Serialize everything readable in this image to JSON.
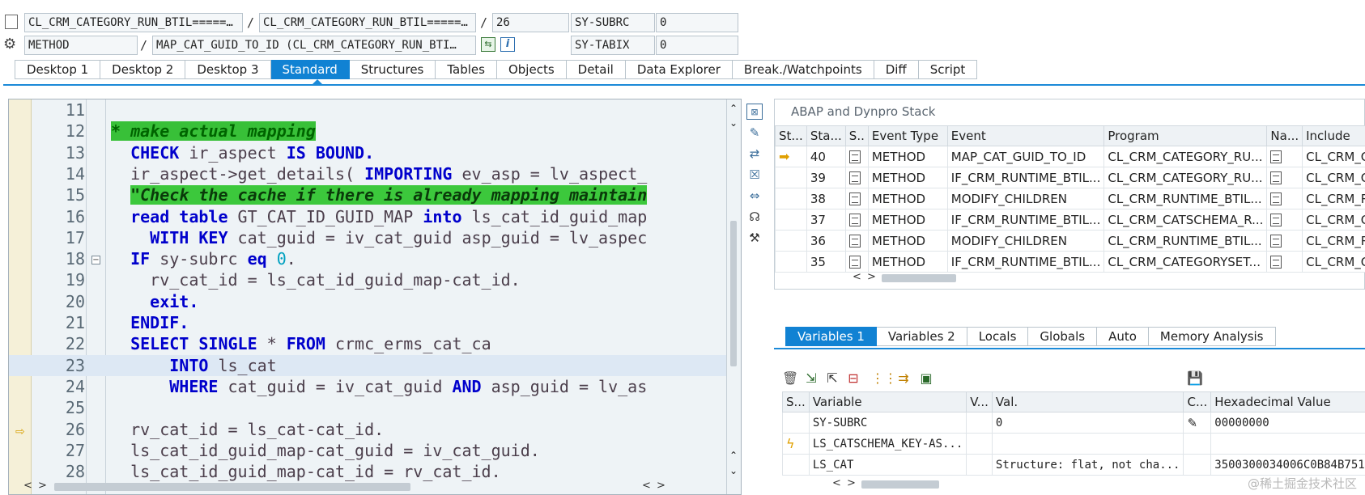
{
  "header": {
    "program_field": "CL_CRM_CATEGORY_RUN_BTIL=====…",
    "program_field2": "CL_CRM_CATEGORY_RUN_BTIL=====…",
    "line_no": "26",
    "sysfield1_name": "SY-SUBRC",
    "sysfield1_value": "0",
    "type_label": "METHOD",
    "method_field": "MAP_CAT_GUID_TO_ID (CL_CRM_CATEGORY_RUN_BTI…",
    "sysfield2_name": "SY-TABIX",
    "sysfield2_value": "0",
    "slash": "/"
  },
  "tabs": [
    {
      "label": "Desktop 1",
      "active": false
    },
    {
      "label": "Desktop 2",
      "active": false
    },
    {
      "label": "Desktop 3",
      "active": false
    },
    {
      "label": "Standard",
      "active": true
    },
    {
      "label": "Structures",
      "active": false
    },
    {
      "label": "Tables",
      "active": false
    },
    {
      "label": "Objects",
      "active": false
    },
    {
      "label": "Detail",
      "active": false
    },
    {
      "label": "Data Explorer",
      "active": false
    },
    {
      "label": "Break./Watchpoints",
      "active": false
    },
    {
      "label": "Diff",
      "active": false
    },
    {
      "label": "Script",
      "active": false
    }
  ],
  "code": {
    "lines": [
      {
        "n": "11",
        "segs": []
      },
      {
        "n": "12",
        "segs": [
          {
            "t": "* make actual mapping",
            "c": "cm"
          }
        ]
      },
      {
        "n": "13",
        "segs": [
          {
            "t": "  CHECK",
            "c": "kw"
          },
          {
            "t": " ir_aspect ",
            "c": "mono"
          },
          {
            "t": "IS BOUND",
            "c": "kw"
          },
          {
            "t": ".",
            "c": "kw"
          }
        ]
      },
      {
        "n": "14",
        "segs": [
          {
            "t": "  ir_aspect->get_details( ",
            "c": "mono"
          },
          {
            "t": "IMPORTING",
            "c": "kw"
          },
          {
            "t": " ev_asp = lv_aspect_",
            "c": "mono"
          }
        ]
      },
      {
        "n": "15",
        "segs": [
          {
            "t": "  ",
            "c": "mono"
          },
          {
            "t": "\"Check the cache if there is already mapping maintain",
            "c": "cm2"
          }
        ]
      },
      {
        "n": "16",
        "segs": [
          {
            "t": "  read table",
            "c": "kw"
          },
          {
            "t": " GT_CAT_ID_GUID_MAP ",
            "c": "mono"
          },
          {
            "t": "into",
            "c": "kw"
          },
          {
            "t": " ls_cat_id_guid_map",
            "c": "mono"
          }
        ]
      },
      {
        "n": "17",
        "segs": [
          {
            "t": "    WITH KEY",
            "c": "kw"
          },
          {
            "t": " cat_guid = iv_cat_guid asp_guid = lv_aspec",
            "c": "mono"
          }
        ]
      },
      {
        "n": "18",
        "segs": [
          {
            "t": "  IF",
            "c": "kw"
          },
          {
            "t": " sy-subrc ",
            "c": "mono"
          },
          {
            "t": "eq",
            "c": "kw"
          },
          {
            "t": " ",
            "c": "mono"
          },
          {
            "t": "0",
            "c": "num"
          },
          {
            "t": ".",
            "c": "mono"
          }
        ]
      },
      {
        "n": "19",
        "segs": [
          {
            "t": "    rv_cat_id = ls_cat_id_guid_map-cat_id.",
            "c": "mono"
          }
        ]
      },
      {
        "n": "20",
        "segs": [
          {
            "t": "    exit",
            "c": "kw"
          },
          {
            "t": ".",
            "c": "kw"
          }
        ]
      },
      {
        "n": "21",
        "segs": [
          {
            "t": "  ENDIF",
            "c": "kw"
          },
          {
            "t": ".",
            "c": "kw"
          }
        ]
      },
      {
        "n": "22",
        "segs": [
          {
            "t": "  SELECT SINGLE",
            "c": "kw"
          },
          {
            "t": " * ",
            "c": "mono"
          },
          {
            "t": "FROM",
            "c": "kw"
          },
          {
            "t": " crmc_erms_cat_ca",
            "c": "mono"
          }
        ]
      },
      {
        "n": "23",
        "segs": [
          {
            "t": "      INTO",
            "c": "kw"
          },
          {
            "t": " ls_cat",
            "c": "mono"
          }
        ]
      },
      {
        "n": "24",
        "segs": [
          {
            "t": "      WHERE",
            "c": "kw"
          },
          {
            "t": " cat_guid = iv_cat_guid ",
            "c": "mono"
          },
          {
            "t": "AND",
            "c": "kw"
          },
          {
            "t": " asp_guid = lv_as",
            "c": "mono"
          }
        ]
      },
      {
        "n": "25",
        "segs": []
      },
      {
        "n": "26",
        "segs": [
          {
            "t": "  rv_cat_id = ls_cat-cat_id.",
            "c": "mono"
          }
        ]
      },
      {
        "n": "27",
        "segs": [
          {
            "t": "  ls_cat_id_guid_map-cat_guid = iv_cat_guid.",
            "c": "mono"
          }
        ]
      },
      {
        "n": "28",
        "segs": [
          {
            "t": "  ls_cat_id_guid_map-cat_id = rv_cat_id.",
            "c": "mono"
          }
        ]
      }
    ]
  },
  "stack": {
    "title": "ABAP and Dynpro Stack",
    "columns": [
      "St...",
      "Sta...",
      "S..",
      "Event Type",
      "Event",
      "Program",
      "Na...",
      "Include"
    ],
    "rows": [
      {
        "level": "40",
        "type": "METHOD",
        "event": "MAP_CAT_GUID_TO_ID",
        "program": "CL_CRM_CATEGORY_RU...",
        "include": "CL_CRM_C",
        "current": true
      },
      {
        "level": "39",
        "type": "METHOD",
        "event": "IF_CRM_RUNTIME_BTIL...",
        "program": "CL_CRM_CATEGORY_RU...",
        "include": "CL_CRM_C",
        "current": false
      },
      {
        "level": "38",
        "type": "METHOD",
        "event": "MODIFY_CHILDREN",
        "program": "CL_CRM_RUNTIME_BTIL...",
        "include": "CL_CRM_R",
        "current": false
      },
      {
        "level": "37",
        "type": "METHOD",
        "event": "IF_CRM_RUNTIME_BTIL...",
        "program": "CL_CRM_CATSCHEMA_R...",
        "include": "CL_CRM_C",
        "current": false
      },
      {
        "level": "36",
        "type": "METHOD",
        "event": "MODIFY_CHILDREN",
        "program": "CL_CRM_RUNTIME_BTIL...",
        "include": "CL_CRM_R",
        "current": false
      },
      {
        "level": "35",
        "type": "METHOD",
        "event": "IF_CRM_RUNTIME_BTIL...",
        "program": "CL_CRM_CATEGORYSET...",
        "include": "CL_CRM_C",
        "current": false
      }
    ]
  },
  "var_tabs": [
    {
      "label": "Variables 1",
      "active": true
    },
    {
      "label": "Variables 2",
      "active": false
    },
    {
      "label": "Locals",
      "active": false
    },
    {
      "label": "Globals",
      "active": false
    },
    {
      "label": "Auto",
      "active": false
    },
    {
      "label": "Memory Analysis",
      "active": false
    }
  ],
  "vars": {
    "columns": [
      "S...",
      "Variable",
      "V...",
      "Val.",
      "C...",
      "Hexadecimal Value"
    ],
    "rows": [
      {
        "variable": "SY-SUBRC",
        "value": "0",
        "hex": "00000000",
        "icon": ""
      },
      {
        "variable": "LS_CATSCHEMA_KEY-AS...",
        "value": "",
        "hex": "",
        "icon": "lightning"
      },
      {
        "variable": "LS_CAT",
        "value": "Structure: flat, not cha...",
        "hex": "3500300034006C0B84B751",
        "icon": ""
      }
    ]
  },
  "watermark": "@稀土掘金技术社区"
}
